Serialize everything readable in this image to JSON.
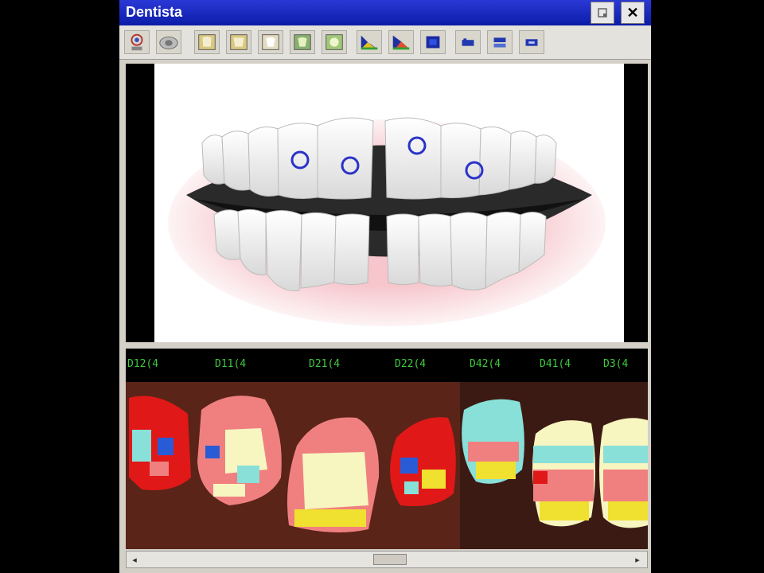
{
  "window": {
    "title": "Dentista",
    "minimize_label": "",
    "close_label": "✕"
  },
  "toolbar": {
    "tools": [
      {
        "icon": "patient-icon"
      },
      {
        "icon": "camera-icon"
      },
      {
        "icon": "tooth-1-icon"
      },
      {
        "icon": "tooth-2-icon"
      },
      {
        "icon": "tooth-3-icon"
      },
      {
        "icon": "tooth-4-icon"
      },
      {
        "icon": "tooth-5-icon"
      },
      {
        "icon": "chart-a-icon"
      },
      {
        "icon": "chart-b-icon"
      },
      {
        "icon": "chart-c-icon"
      },
      {
        "icon": "display-a-icon"
      },
      {
        "icon": "display-b-icon"
      },
      {
        "icon": "display-c-icon"
      }
    ]
  },
  "colors": {
    "title_bar": "#0c1ca8",
    "code_text": "#3ec93e",
    "shade_a": "#f08080",
    "shade_b": "#f7f5c0",
    "shade_c": "#88e0d8",
    "shade_red": "#e01818",
    "shade_blue": "#2a5bd7",
    "shade_yellow": "#f0e030"
  },
  "teeth_codes": [
    "D12(4",
    "D11(4",
    "D21(4",
    "D22(4",
    "D42(4",
    "D41(4",
    "D3(4"
  ],
  "scrollbar": {
    "left_arrow": "◂",
    "right_arrow": "▸"
  }
}
